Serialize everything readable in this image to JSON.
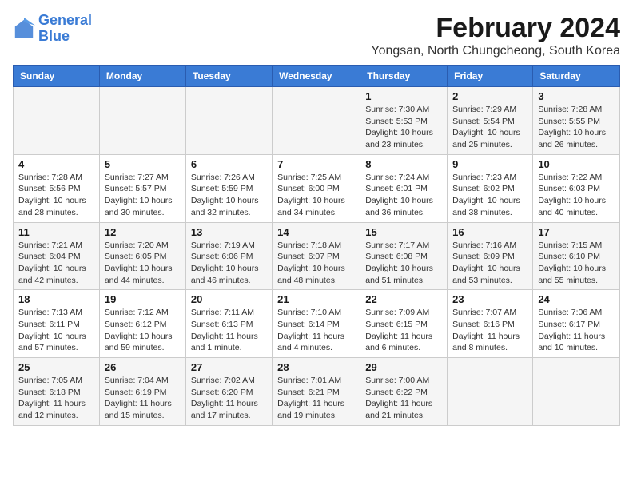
{
  "logo": {
    "line1": "General",
    "line2": "Blue"
  },
  "calendar": {
    "title": "February 2024",
    "subtitle": "Yongsan, North Chungcheong, South Korea"
  },
  "days_of_week": [
    "Sunday",
    "Monday",
    "Tuesday",
    "Wednesday",
    "Thursday",
    "Friday",
    "Saturday"
  ],
  "weeks": [
    [
      {
        "day": "",
        "info": ""
      },
      {
        "day": "",
        "info": ""
      },
      {
        "day": "",
        "info": ""
      },
      {
        "day": "",
        "info": ""
      },
      {
        "day": "1",
        "info": "Sunrise: 7:30 AM\nSunset: 5:53 PM\nDaylight: 10 hours\nand 23 minutes."
      },
      {
        "day": "2",
        "info": "Sunrise: 7:29 AM\nSunset: 5:54 PM\nDaylight: 10 hours\nand 25 minutes."
      },
      {
        "day": "3",
        "info": "Sunrise: 7:28 AM\nSunset: 5:55 PM\nDaylight: 10 hours\nand 26 minutes."
      }
    ],
    [
      {
        "day": "4",
        "info": "Sunrise: 7:28 AM\nSunset: 5:56 PM\nDaylight: 10 hours\nand 28 minutes."
      },
      {
        "day": "5",
        "info": "Sunrise: 7:27 AM\nSunset: 5:57 PM\nDaylight: 10 hours\nand 30 minutes."
      },
      {
        "day": "6",
        "info": "Sunrise: 7:26 AM\nSunset: 5:59 PM\nDaylight: 10 hours\nand 32 minutes."
      },
      {
        "day": "7",
        "info": "Sunrise: 7:25 AM\nSunset: 6:00 PM\nDaylight: 10 hours\nand 34 minutes."
      },
      {
        "day": "8",
        "info": "Sunrise: 7:24 AM\nSunset: 6:01 PM\nDaylight: 10 hours\nand 36 minutes."
      },
      {
        "day": "9",
        "info": "Sunrise: 7:23 AM\nSunset: 6:02 PM\nDaylight: 10 hours\nand 38 minutes."
      },
      {
        "day": "10",
        "info": "Sunrise: 7:22 AM\nSunset: 6:03 PM\nDaylight: 10 hours\nand 40 minutes."
      }
    ],
    [
      {
        "day": "11",
        "info": "Sunrise: 7:21 AM\nSunset: 6:04 PM\nDaylight: 10 hours\nand 42 minutes."
      },
      {
        "day": "12",
        "info": "Sunrise: 7:20 AM\nSunset: 6:05 PM\nDaylight: 10 hours\nand 44 minutes."
      },
      {
        "day": "13",
        "info": "Sunrise: 7:19 AM\nSunset: 6:06 PM\nDaylight: 10 hours\nand 46 minutes."
      },
      {
        "day": "14",
        "info": "Sunrise: 7:18 AM\nSunset: 6:07 PM\nDaylight: 10 hours\nand 48 minutes."
      },
      {
        "day": "15",
        "info": "Sunrise: 7:17 AM\nSunset: 6:08 PM\nDaylight: 10 hours\nand 51 minutes."
      },
      {
        "day": "16",
        "info": "Sunrise: 7:16 AM\nSunset: 6:09 PM\nDaylight: 10 hours\nand 53 minutes."
      },
      {
        "day": "17",
        "info": "Sunrise: 7:15 AM\nSunset: 6:10 PM\nDaylight: 10 hours\nand 55 minutes."
      }
    ],
    [
      {
        "day": "18",
        "info": "Sunrise: 7:13 AM\nSunset: 6:11 PM\nDaylight: 10 hours\nand 57 minutes."
      },
      {
        "day": "19",
        "info": "Sunrise: 7:12 AM\nSunset: 6:12 PM\nDaylight: 10 hours\nand 59 minutes."
      },
      {
        "day": "20",
        "info": "Sunrise: 7:11 AM\nSunset: 6:13 PM\nDaylight: 11 hours\nand 1 minute."
      },
      {
        "day": "21",
        "info": "Sunrise: 7:10 AM\nSunset: 6:14 PM\nDaylight: 11 hours\nand 4 minutes."
      },
      {
        "day": "22",
        "info": "Sunrise: 7:09 AM\nSunset: 6:15 PM\nDaylight: 11 hours\nand 6 minutes."
      },
      {
        "day": "23",
        "info": "Sunrise: 7:07 AM\nSunset: 6:16 PM\nDaylight: 11 hours\nand 8 minutes."
      },
      {
        "day": "24",
        "info": "Sunrise: 7:06 AM\nSunset: 6:17 PM\nDaylight: 11 hours\nand 10 minutes."
      }
    ],
    [
      {
        "day": "25",
        "info": "Sunrise: 7:05 AM\nSunset: 6:18 PM\nDaylight: 11 hours\nand 12 minutes."
      },
      {
        "day": "26",
        "info": "Sunrise: 7:04 AM\nSunset: 6:19 PM\nDaylight: 11 hours\nand 15 minutes."
      },
      {
        "day": "27",
        "info": "Sunrise: 7:02 AM\nSunset: 6:20 PM\nDaylight: 11 hours\nand 17 minutes."
      },
      {
        "day": "28",
        "info": "Sunrise: 7:01 AM\nSunset: 6:21 PM\nDaylight: 11 hours\nand 19 minutes."
      },
      {
        "day": "29",
        "info": "Sunrise: 7:00 AM\nSunset: 6:22 PM\nDaylight: 11 hours\nand 21 minutes."
      },
      {
        "day": "",
        "info": ""
      },
      {
        "day": "",
        "info": ""
      }
    ]
  ]
}
